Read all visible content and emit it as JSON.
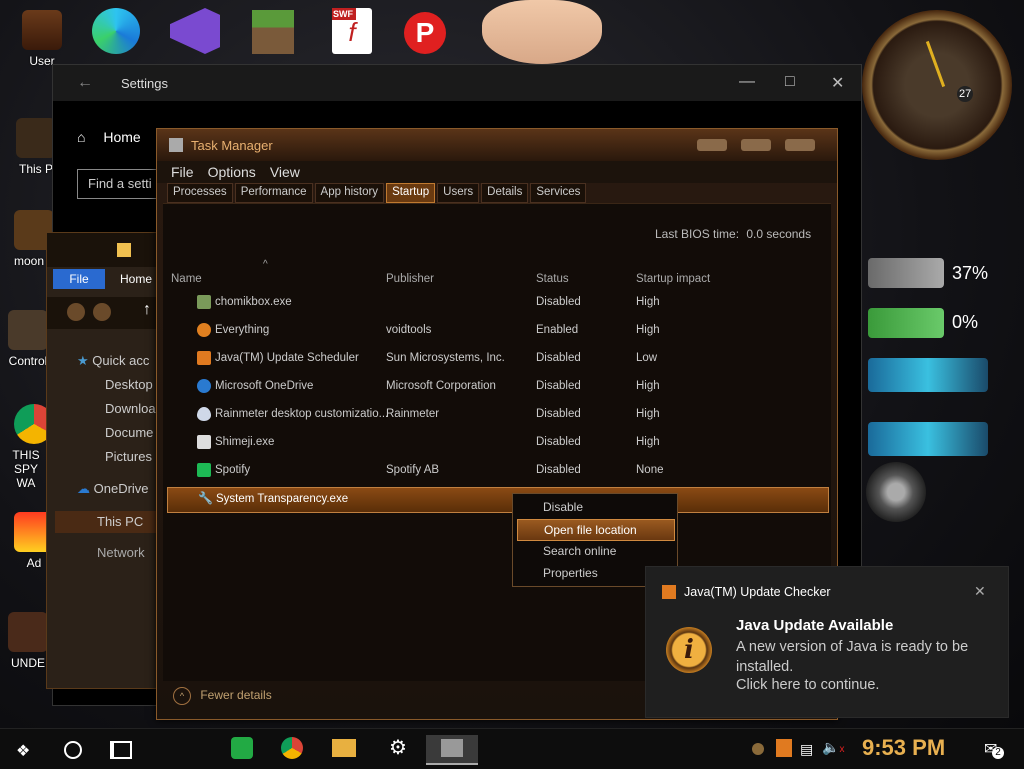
{
  "desktop": {
    "icons": [
      {
        "label": "User"
      },
      {
        "label": "This P"
      },
      {
        "label": "moon g"
      },
      {
        "label": "Control"
      },
      {
        "label": "THIS SPY WA"
      },
      {
        "label": "Ad"
      },
      {
        "label": "UNDE"
      }
    ],
    "top_icons": [
      "edge-icon",
      "visual-studio-icon",
      "minecraft-icon",
      "swf-flash-icon",
      "p-app-icon",
      "cartoon-face-icon"
    ],
    "clock": {
      "day": "27"
    },
    "gauges": [
      {
        "label": "37%",
        "value": 37
      },
      {
        "label": "0%",
        "value": 0
      }
    ]
  },
  "settings": {
    "title": "Settings",
    "home_label": "Home",
    "search_placeholder": "Find a setti"
  },
  "explorer": {
    "tabs": [
      "File",
      "Home"
    ],
    "nav": [
      "Quick acc",
      "Desktop",
      "Downloa",
      "Docume",
      "Pictures",
      "OneDrive",
      "This PC",
      "Network"
    ]
  },
  "taskmanager": {
    "title": "Task Manager",
    "menu": [
      "File",
      "Options",
      "View"
    ],
    "tabs": [
      "Processes",
      "Performance",
      "App history",
      "Startup",
      "Users",
      "Details",
      "Services"
    ],
    "active_tab": "Startup",
    "bios_label": "Last BIOS time:",
    "bios_value": "0.0 seconds",
    "columns": [
      "Name",
      "Publisher",
      "Status",
      "Startup impact"
    ],
    "rows": [
      {
        "name": "chomikbox.exe",
        "publisher": "",
        "status": "Disabled",
        "impact": "High",
        "color": "#7a9a5a"
      },
      {
        "name": "Everything",
        "publisher": "voidtools",
        "status": "Enabled",
        "impact": "High",
        "color": "#e08020"
      },
      {
        "name": "Java(TM) Update Scheduler",
        "publisher": "Sun Microsystems, Inc.",
        "status": "Disabled",
        "impact": "Low",
        "color": "#e07a20"
      },
      {
        "name": "Microsoft OneDrive",
        "publisher": "Microsoft Corporation",
        "status": "Disabled",
        "impact": "High",
        "color": "#2a7ad0"
      },
      {
        "name": "Rainmeter desktop customizatio...",
        "publisher": "Rainmeter",
        "status": "Disabled",
        "impact": "High",
        "color": "#cfd8e8"
      },
      {
        "name": "Shimeji.exe",
        "publisher": "",
        "status": "Disabled",
        "impact": "High",
        "color": "#dddddd"
      },
      {
        "name": "Spotify",
        "publisher": "Spotify AB",
        "status": "Disabled",
        "impact": "None",
        "color": "#1db954"
      },
      {
        "name": "System Transparency.exe",
        "publisher": "",
        "status": "",
        "impact": "",
        "color": "#999999"
      }
    ],
    "fewer_details": "Fewer details"
  },
  "context_menu": {
    "items": [
      "Disable",
      "Open file location",
      "Search online",
      "Properties"
    ],
    "highlighted": "Open file location"
  },
  "notification": {
    "app": "Java(TM) Update Checker",
    "heading": "Java Update Available",
    "body": "A new version of Java is ready to be installed.",
    "action": "Click here to continue."
  },
  "taskbar": {
    "time": "9:53 PM",
    "notification_count": "2"
  }
}
